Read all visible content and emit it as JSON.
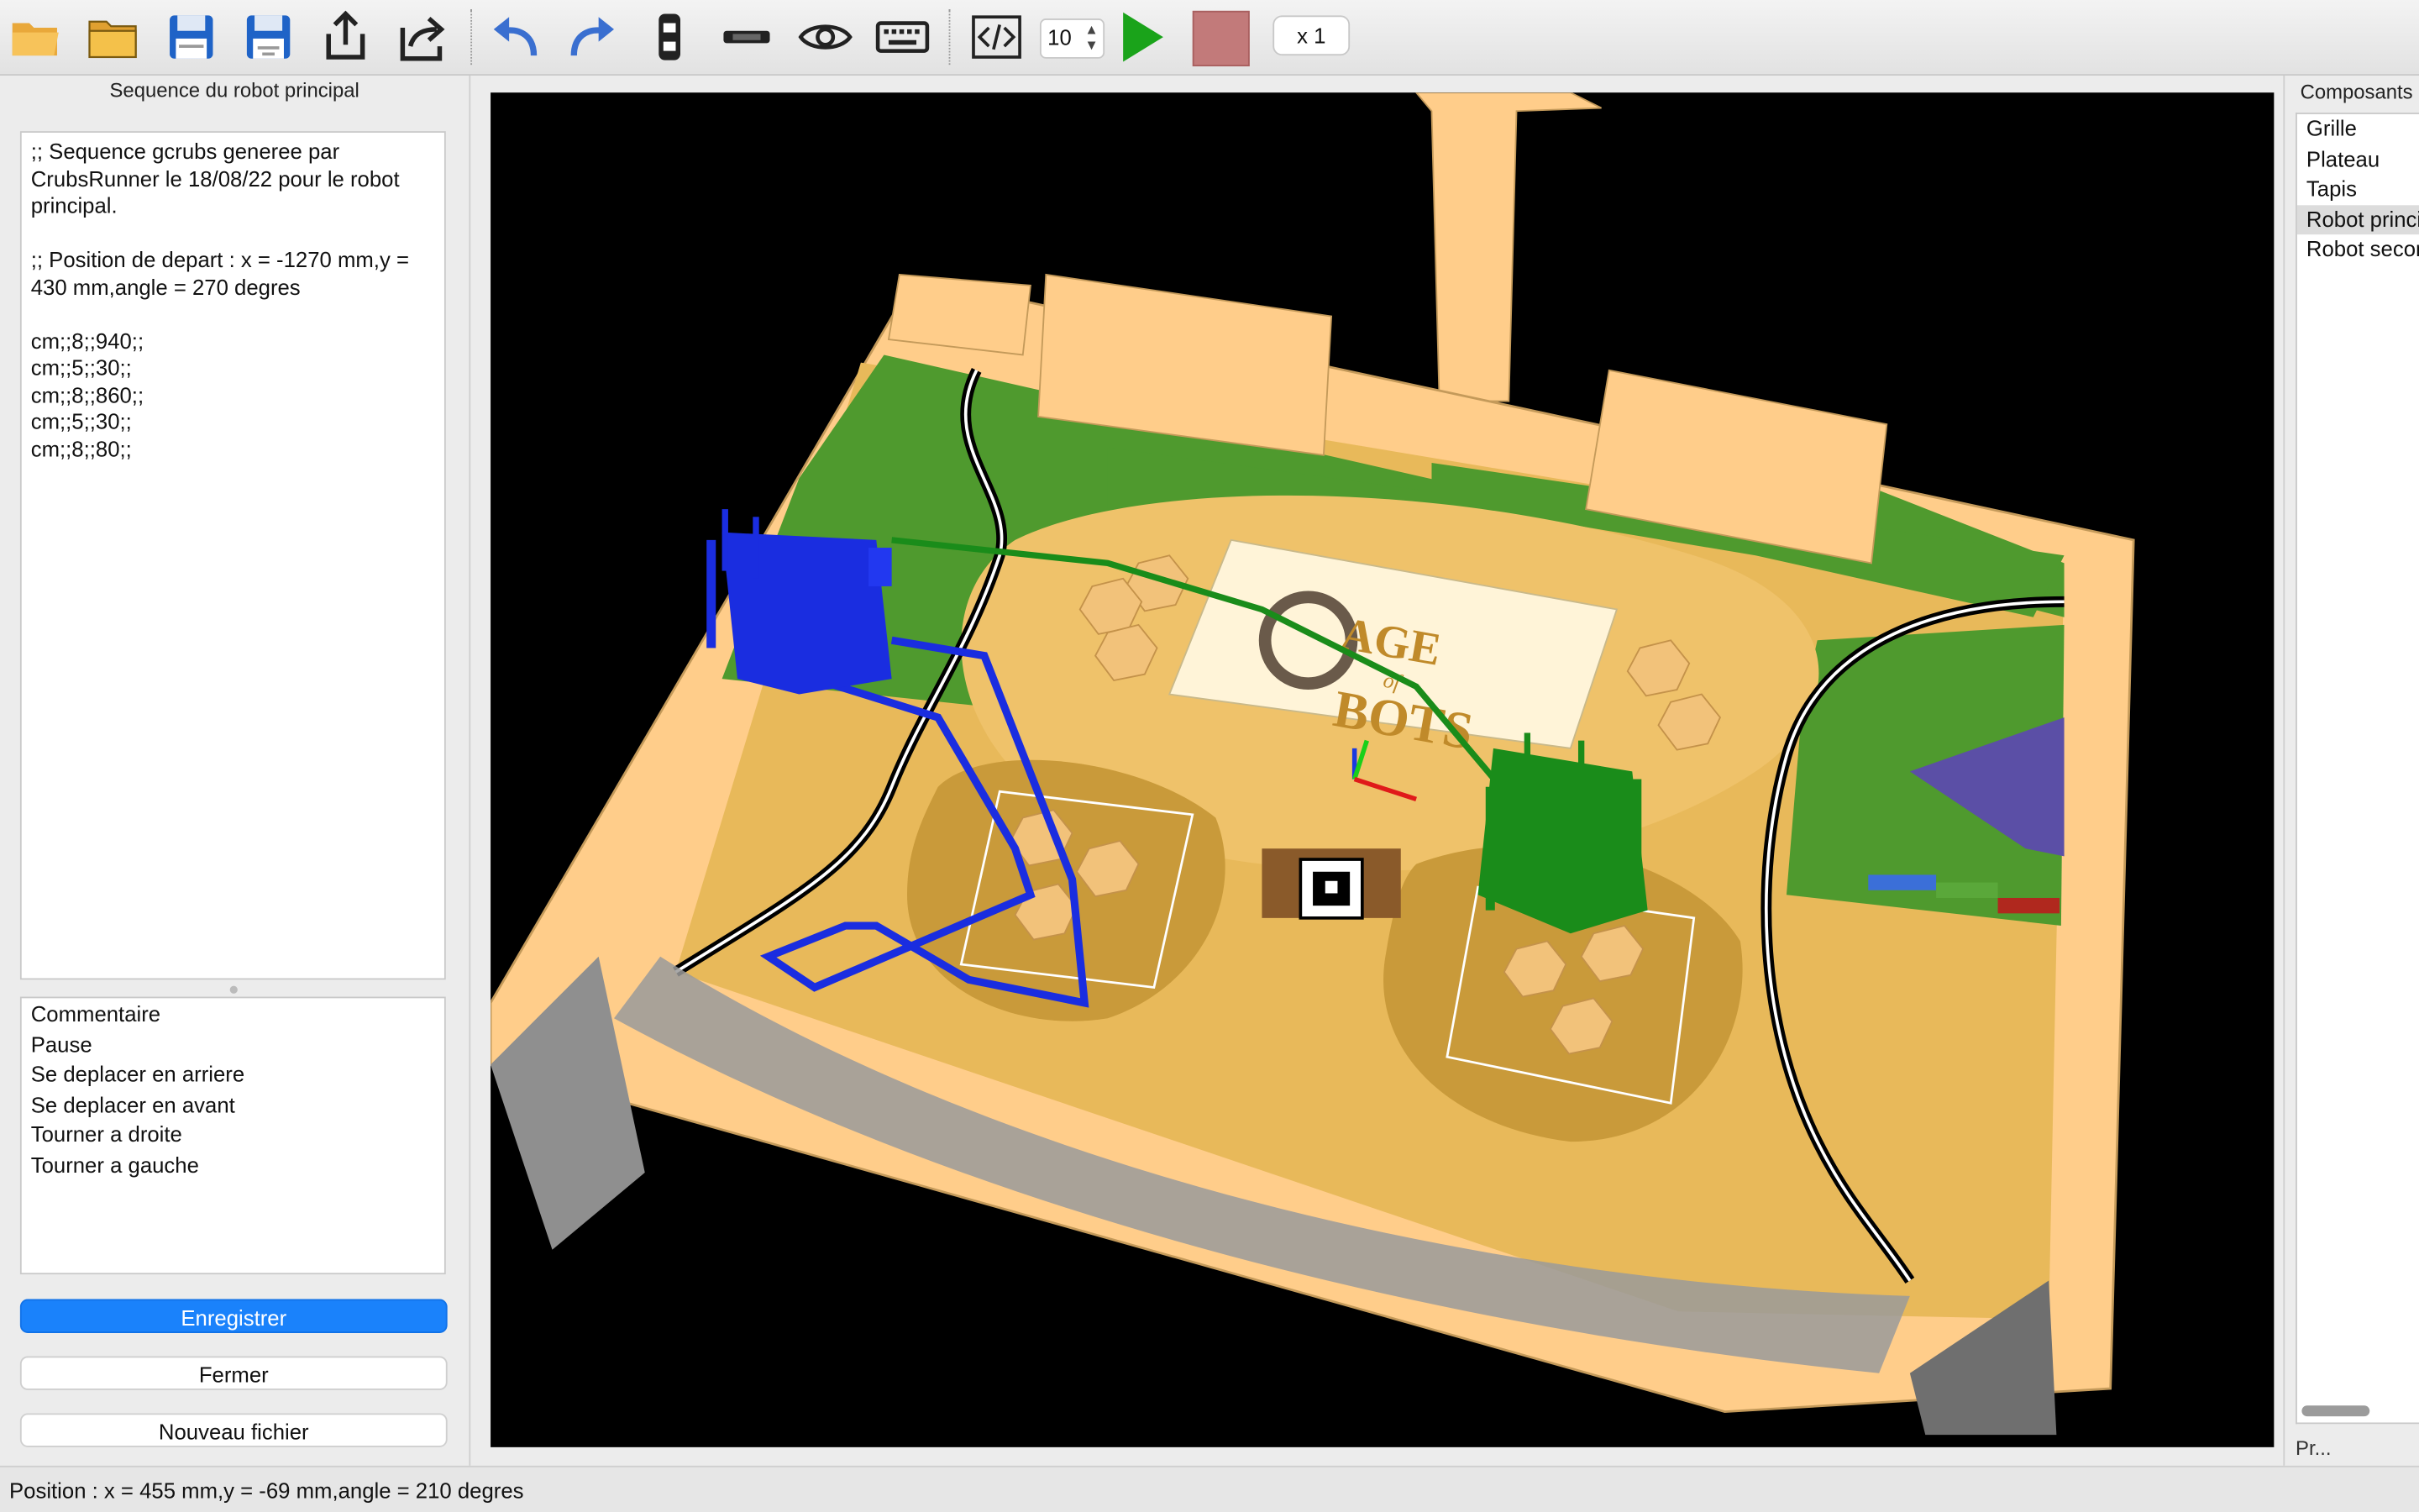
{
  "toolbar": {
    "buttons": [
      {
        "icon": "open-folder-icon"
      },
      {
        "icon": "folder-icon"
      },
      {
        "icon": "save-icon"
      },
      {
        "icon": "save-as-icon"
      },
      {
        "icon": "upload-icon"
      },
      {
        "icon": "share-icon"
      },
      {
        "icon": "undo-icon"
      },
      {
        "icon": "redo-icon"
      },
      {
        "icon": "robot-view-icon"
      },
      {
        "icon": "robot-side-icon"
      },
      {
        "icon": "eye-icon"
      },
      {
        "icon": "keyboard-icon"
      },
      {
        "icon": "code-icon"
      },
      {
        "icon": "play-icon"
      },
      {
        "icon": "stop-icon"
      }
    ],
    "step_value": "10",
    "speed_label": "x 1",
    "colors": {
      "play": "#1aa31a",
      "stop": "#c27a7a",
      "accent": "#3a6fd0"
    }
  },
  "left_panel": {
    "title": "Sequence du robot principal",
    "editor_text": ";; Sequence gcrubs generee par CrubsRunner le 18/08/22 pour le robot principal.\n\n;; Position de depart : x = -1270 mm,y = 430 mm,angle = 270 degres\n\ncm;;8;;940;;\ncm;;5;;30;;\ncm;;8;;860;;\ncm;;5;;30;;\ncm;;8;;80;;",
    "commands": [
      "Commentaire",
      "Pause",
      "Se deplacer en arriere",
      "Se deplacer en avant",
      "Tourner a droite",
      "Tourner a gauche"
    ],
    "save_button": "Enregistrer",
    "close_button": "Fermer",
    "new_file_button": "Nouveau fichier"
  },
  "scene": {
    "banner_line1": "AGE",
    "banner_line2": "of",
    "banner_line3": "BOTS",
    "colors": {
      "table": "#ffcd8a",
      "sand": "#e8b95a",
      "dark_sand": "#c99a3a",
      "grass": "#4f9a2e",
      "blue_robot": "#1a2de0",
      "green_robot": "#1a8c1a"
    }
  },
  "right_panel": {
    "title": "Composants",
    "items": [
      "Grille",
      "Plateau",
      "Tapis",
      "Robot principal",
      "Robot secondaire"
    ],
    "selected": "Robot principal",
    "footer": "Pr..."
  },
  "status_bar": {
    "text": "Position : x = 455 mm,y = -69 mm,angle = 210 degres"
  }
}
